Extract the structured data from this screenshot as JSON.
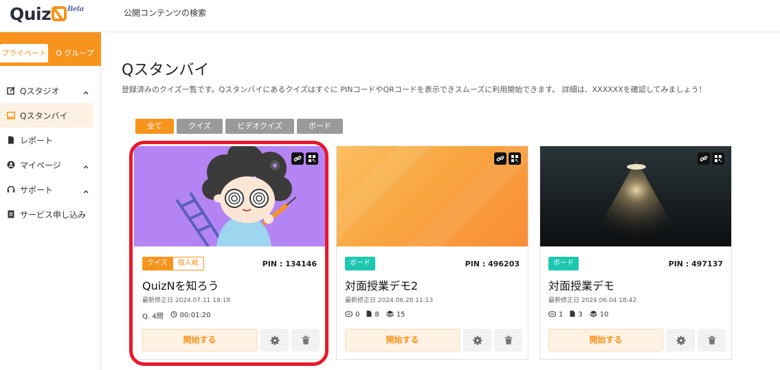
{
  "header": {
    "logo_text": "Quiz",
    "logo_badge": "Beta",
    "nav_link": "公開コンテンツの検索"
  },
  "sidebar": {
    "tabs": [
      {
        "label": "プライベート",
        "active": true
      },
      {
        "label": "Q グループ",
        "active": false
      }
    ],
    "items": [
      {
        "label": "Qスタジオ",
        "icon": "edit-icon",
        "expandable": true
      },
      {
        "label": "Qスタンバイ",
        "icon": "monitor-icon",
        "active": true
      },
      {
        "label": "レポート",
        "icon": "file-icon"
      },
      {
        "label": "マイページ",
        "icon": "user-icon",
        "expandable": true
      },
      {
        "label": "サポート",
        "icon": "headset-icon",
        "expandable": true
      },
      {
        "label": "サービス申し込み",
        "icon": "document-icon"
      }
    ]
  },
  "main": {
    "title": "Qスタンバイ",
    "description": "登録済みのクイズ一覧です。Qスタンバイにあるクイズはすぐに PINコードやQRコードを表示できスムーズに利用開始できます。 詳細は、XXXXXXを確認してみましょう！",
    "filters": [
      {
        "label": "全て",
        "active": true
      },
      {
        "label": "クイズ"
      },
      {
        "label": "ビデオクイズ"
      },
      {
        "label": "ボード"
      }
    ]
  },
  "cards": [
    {
      "tag1": "クイズ",
      "tag2": "個人戦",
      "pin": "PIN : 134146",
      "title": "QuizNを知ろう",
      "updated": "最新修正日 2024.07.11 18:18",
      "meta1": "Q. 4問",
      "meta2": "00:01:20",
      "start_label": "開始する",
      "highlighted": true
    },
    {
      "tag1": "ボード",
      "pin": "PIN : 496203",
      "title": "対面授業デモ2",
      "updated": "最新修正日 2024.06.28 11:13",
      "stat1": "0",
      "stat2": "8",
      "stat3": "15",
      "start_label": "開始する"
    },
    {
      "tag1": "ボード",
      "pin": "PIN : 497137",
      "title": "対面授業デモ",
      "updated": "最新修正日 2024.06.04 18:42",
      "stat1": "1",
      "stat2": "3",
      "stat3": "10",
      "start_label": "開始する"
    }
  ],
  "colors": {
    "accent": "#f7941d",
    "board_tag": "#1dc7b0",
    "highlight_ring": "#e8182a",
    "card1_bg": "#b484f5"
  }
}
